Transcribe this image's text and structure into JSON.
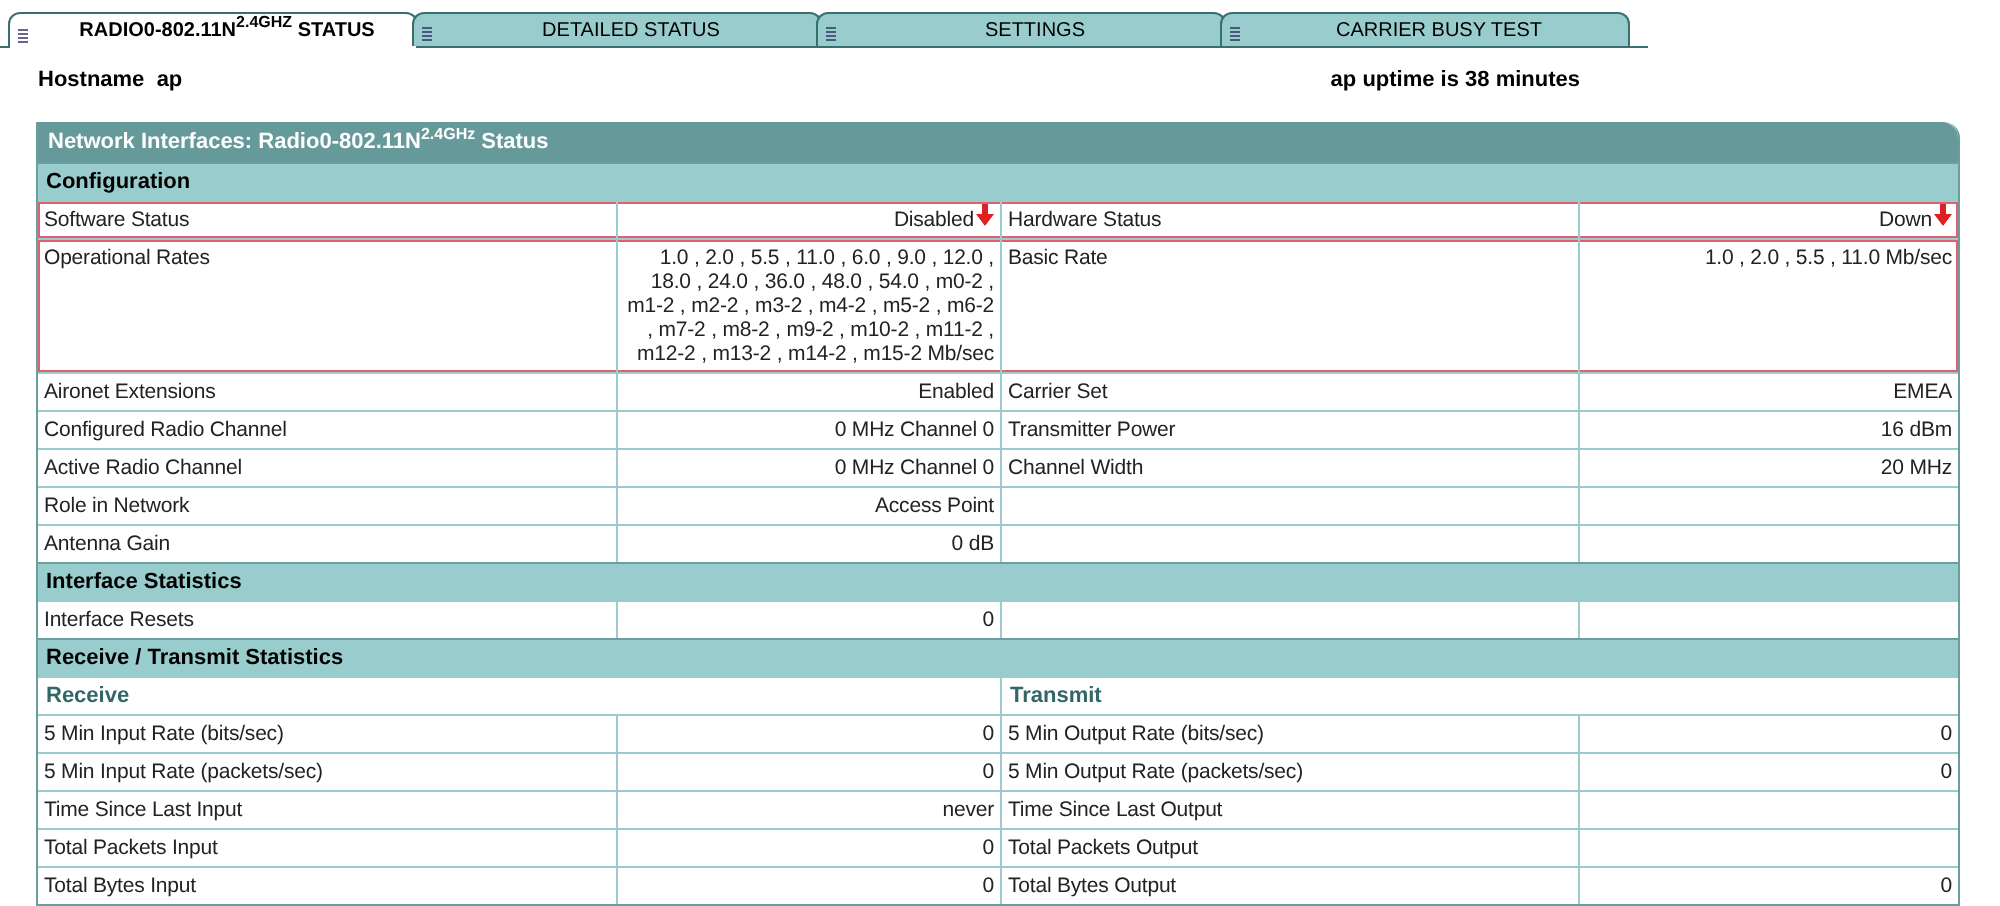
{
  "tabs": [
    {
      "label": "RADIO0-802.11N$^{2.4GHZ}$ STATUS",
      "selected": true
    },
    {
      "label": "DETAILED STATUS",
      "selected": false
    },
    {
      "label": "SETTINGS",
      "selected": false
    },
    {
      "label": "CARRIER BUSY TEST",
      "selected": false
    }
  ],
  "hostname": {
    "label": "Hostname",
    "value": "ap"
  },
  "uptime": "ap uptime is 38 minutes",
  "panel": {
    "title": "Network Interfaces: Radio0-802.11N$^{2.4GHz}$ Status",
    "sections": [
      {
        "title": "Configuration",
        "rows": [
          {
            "kind": "pair",
            "highlighted": true,
            "left": {
              "label": "Software Status",
              "value": "Disabled",
              "flagged": true
            },
            "right": {
              "label": "Hardware Status",
              "value": "Down",
              "flagged": true
            }
          },
          {
            "kind": "pair",
            "highlighted": true,
            "left": {
              "label": "Operational Rates",
              "value": "1.0 , 2.0 , 5.5 , 11.0 , 6.0 , 9.0 , 12.0 , 18.0 , 24.0 , 36.0 , 48.0 , 54.0 , m0-2 , m1-2 , m2-2 , m3-2 , m4-2 , m5-2 , m6-2 , m7-2 , m8-2 , m9-2 , m10-2 , m11-2 , m12-2 , m13-2 , m14-2 , m15-2 Mb/sec",
              "flagged": false
            },
            "right": {
              "label": "Basic Rate",
              "value": "1.0 , 2.0 , 5.5 , 11.0 Mb/sec",
              "flagged": false
            }
          },
          {
            "kind": "pair",
            "highlighted": false,
            "left": {
              "label": "Aironet Extensions",
              "value": "Enabled",
              "flagged": false
            },
            "right": {
              "label": "Carrier Set",
              "value": "EMEA",
              "flagged": false
            }
          },
          {
            "kind": "pair",
            "highlighted": false,
            "left": {
              "label": "Configured Radio Channel",
              "value": "0 MHz Channel 0",
              "flagged": false
            },
            "right": {
              "label": "Transmitter Power",
              "value": "16 dBm",
              "flagged": false
            }
          },
          {
            "kind": "pair",
            "highlighted": false,
            "left": {
              "label": "Active Radio Channel",
              "value": "0 MHz Channel 0",
              "flagged": false
            },
            "right": {
              "label": "Channel Width",
              "value": "20 MHz",
              "flagged": false
            }
          },
          {
            "kind": "pair",
            "highlighted": false,
            "left": {
              "label": "Role in Network",
              "value": "Access Point",
              "flagged": false
            }
          },
          {
            "kind": "pair",
            "highlighted": false,
            "left": {
              "label": "Antenna Gain",
              "value": "0 dB",
              "flagged": false
            }
          }
        ]
      },
      {
        "title": "Interface Statistics",
        "rows": [
          {
            "kind": "pair",
            "highlighted": false,
            "left": {
              "label": "Interface Resets",
              "value": "0",
              "flagged": false
            }
          }
        ]
      },
      {
        "title": "Receive / Transmit Statistics",
        "rows": [
          {
            "kind": "subheader",
            "left": "Receive",
            "right": "Transmit"
          },
          {
            "kind": "pair",
            "highlighted": false,
            "left": {
              "label": "5 Min Input Rate (bits/sec)",
              "value": "0",
              "flagged": false
            },
            "right": {
              "label": "5 Min Output Rate (bits/sec)",
              "value": "0",
              "flagged": false
            }
          },
          {
            "kind": "pair",
            "highlighted": false,
            "left": {
              "label": "5 Min Input Rate (packets/sec)",
              "value": "0",
              "flagged": false
            },
            "right": {
              "label": "5 Min Output Rate (packets/sec)",
              "value": "0",
              "flagged": false
            }
          },
          {
            "kind": "pair",
            "highlighted": false,
            "left": {
              "label": "Time Since Last Input",
              "value": "never",
              "flagged": false
            },
            "right": {
              "label": "Time Since Last Output",
              "flagged": false
            }
          },
          {
            "kind": "pair",
            "highlighted": false,
            "left": {
              "label": "Total Packets Input",
              "value": "0",
              "flagged": false
            },
            "right": {
              "label": "Total Packets Output",
              "flagged": false
            }
          },
          {
            "kind": "pair",
            "highlighted": false,
            "left": {
              "label": "Total Bytes Input",
              "value": "0",
              "flagged": false
            },
            "right": {
              "label": "Total Bytes Output",
              "value": "0",
              "flagged": false
            }
          }
        ]
      }
    ]
  }
}
